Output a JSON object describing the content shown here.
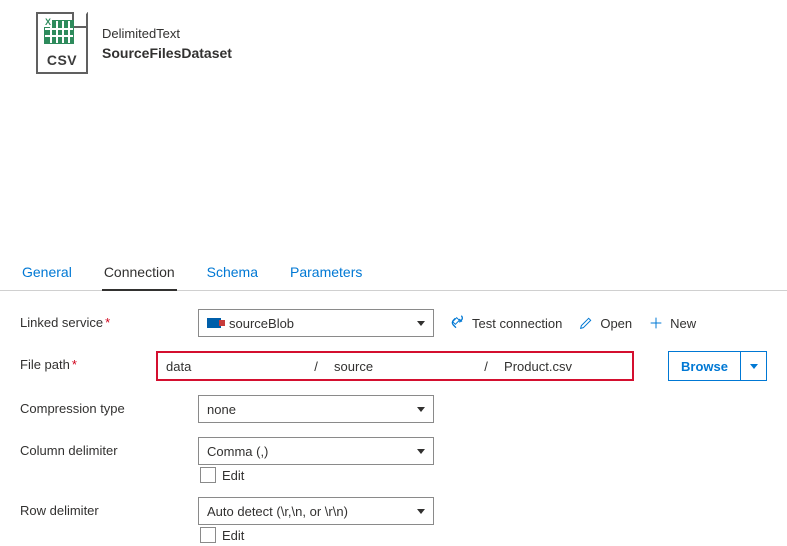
{
  "header": {
    "type_label": "DelimitedText",
    "name": "SourceFilesDataset",
    "file_ext_badge": "CSV"
  },
  "tabs": {
    "general": "General",
    "connection": "Connection",
    "schema": "Schema",
    "parameters": "Parameters"
  },
  "form": {
    "linked_service": {
      "label": "Linked service",
      "value": "sourceBlob",
      "test_connection": "Test connection",
      "open": "Open",
      "new": "New"
    },
    "file_path": {
      "label": "File path",
      "container": "data",
      "folder": "source",
      "file": "Product.csv",
      "browse": "Browse"
    },
    "compression": {
      "label": "Compression type",
      "value": "none"
    },
    "column_delim": {
      "label": "Column delimiter",
      "value": "Comma (,)",
      "edit": "Edit"
    },
    "row_delim": {
      "label": "Row delimiter",
      "value": "Auto detect (\\r,\\n, or \\r\\n)",
      "edit": "Edit"
    }
  }
}
